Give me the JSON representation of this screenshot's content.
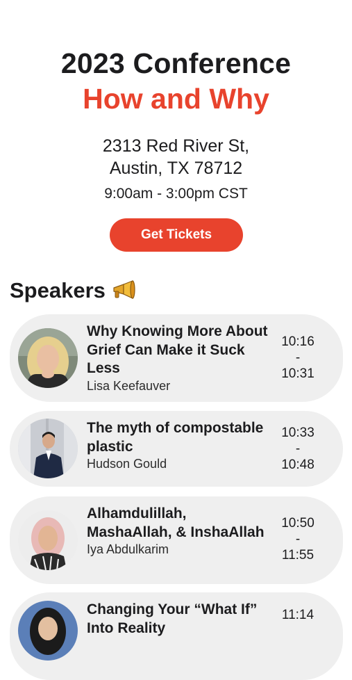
{
  "conference": {
    "title_line1": "2023 Conference",
    "title_line2": "How and Why",
    "address_line1": "2313 Red River St,",
    "address_line2": "Austin, TX 78712",
    "hours": "9:00am - 3:00pm CST",
    "accent_color": "#e8432d"
  },
  "tickets_button": {
    "label": "Get Tickets"
  },
  "speakers_section": {
    "heading": "Speakers",
    "heading_icon": "megaphone-icon"
  },
  "speakers": [
    {
      "title": "Why Knowing More About Grief Can Make it Suck Less",
      "name": "Lisa Keefauver",
      "start": "10:16",
      "sep": "-",
      "end": "10:31"
    },
    {
      "title": "The myth of compostable plastic",
      "name": "Hudson Gould",
      "start": "10:33",
      "sep": "-",
      "end": "10:48"
    },
    {
      "title": "Alhamdulillah, MashaAllah, & InshaAllah",
      "name": "Iya Abdulkarim",
      "start": "10:50",
      "sep": "-",
      "end": "11:55"
    },
    {
      "title": "Changing Your “What If” Into Reality",
      "name": "",
      "start": "11:14",
      "sep": "",
      "end": ""
    }
  ]
}
